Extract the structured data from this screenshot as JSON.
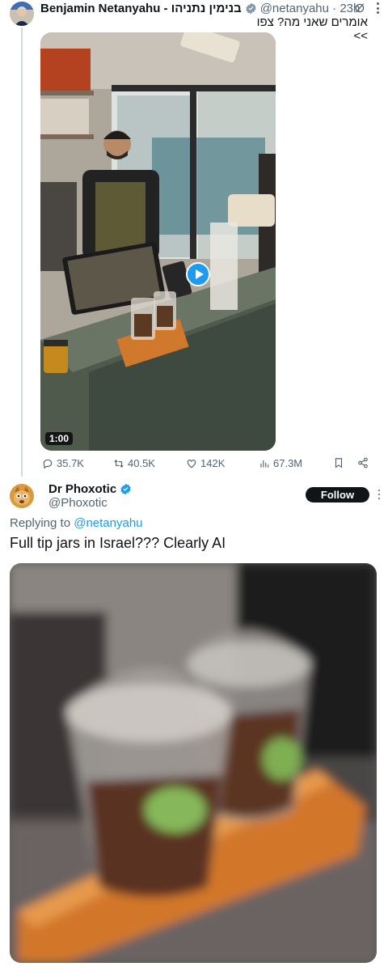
{
  "tweet": {
    "author_name": "Benjamin Netanyahu - בנימין נתניהו",
    "handle": "@netanyahu",
    "time": "23h",
    "text": "אומרים שאני מה? צפו >>",
    "video_duration": "1:00",
    "stats": {
      "replies": "35.7K",
      "retweets": "40.5K",
      "likes": "142K",
      "views": "67.3M"
    },
    "icons": [
      "verified-badge-icon",
      "grok-icon",
      "more-icon",
      "play-icon",
      "reply-icon",
      "retweet-icon",
      "like-icon",
      "views-icon",
      "bookmark-icon",
      "share-icon"
    ]
  },
  "reply": {
    "author_name": "Dr Phoxotic",
    "handle": "@Phoxotic",
    "follow_label": "Follow",
    "replying_prefix": "Replying to",
    "replying_handle": "@netanyahu",
    "text": "Full tip jars in Israel??? Clearly AI"
  },
  "colors": {
    "accent": "#1d9bf0",
    "text_primary": "#0f1419",
    "text_secondary": "#536471",
    "follow_button": "#0f1419"
  }
}
